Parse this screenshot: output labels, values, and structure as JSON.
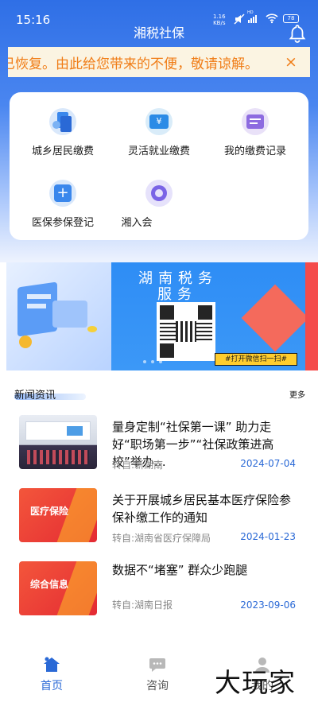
{
  "status_bar": {
    "time": "15:16",
    "net_speed": "1.16",
    "net_unit": "KB/s",
    "network_type": "HD",
    "battery": "78"
  },
  "header": {
    "title": "湘税社保"
  },
  "notice": {
    "text": "已恢复。由此给您带来的不便，敬请谅解。",
    "close": "×"
  },
  "menu": {
    "items": [
      {
        "label": "城乡居民缴费",
        "icon": "document-stack-icon"
      },
      {
        "label": "灵活就业缴费",
        "icon": "yuan-wallet-icon"
      },
      {
        "label": "我的缴费记录",
        "icon": "payment-record-icon"
      },
      {
        "label": "医保参保登记",
        "icon": "medical-cross-icon"
      },
      {
        "label": "湘入会",
        "icon": "union-badge-icon"
      }
    ]
  },
  "banner": {
    "title_line1": "湖南税务",
    "title_line2": "服务",
    "scan_text": "#打开微信扫一扫#",
    "colors": {
      "mid": "#2e8df5",
      "right": "#f44b4b",
      "scan": "#ffcd2e"
    }
  },
  "news": {
    "section_title": "新闻资讯",
    "more": "更多",
    "items": [
      {
        "headline": "量身定制“社保第一课” 助力走好“职场第一步”“社保政策进高校”举办…",
        "source": "转自:新湖南",
        "date": "2024-07-04",
        "thumb_text": ""
      },
      {
        "headline": "关于开展城乡居民基本医疗保险参保补缴工作的通知",
        "source": "转自:湖南省医疗保障局",
        "date": "2024-01-23",
        "thumb_text": "医疗保险"
      },
      {
        "headline": "数据不“堵塞” 群众少跑腿",
        "source": "转自:湖南日报",
        "date": "2023-09-06",
        "thumb_text": "综合信息"
      }
    ]
  },
  "tabbar": {
    "tabs": [
      {
        "label": "首页",
        "active": true,
        "icon": "home-icon"
      },
      {
        "label": "咨询",
        "active": false,
        "icon": "chat-icon"
      },
      {
        "label": "我的",
        "active": false,
        "icon": "user-icon"
      }
    ],
    "active_color": "#2a69d6",
    "inactive_color": "#555555"
  },
  "watermark": "大玩家"
}
